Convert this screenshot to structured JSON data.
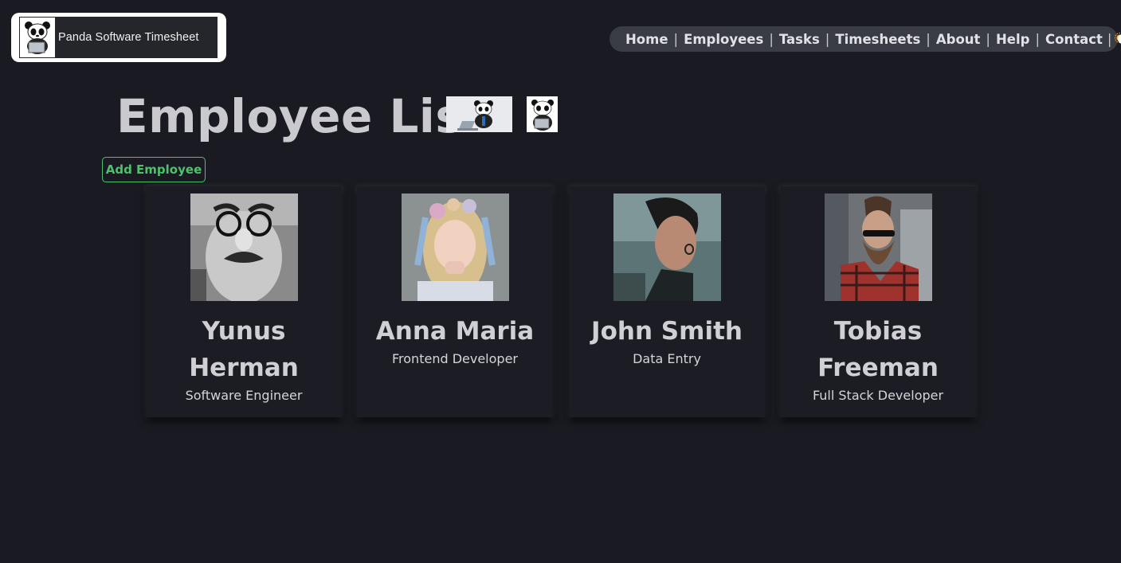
{
  "header": {
    "logo_text": "Panda Software Timesheet"
  },
  "nav": {
    "items": [
      "Home",
      "Employees",
      "Tasks",
      "Timesheets",
      "About",
      "Help",
      "Contact"
    ],
    "separator": "|",
    "theme_sun_icon": "sun-icon",
    "theme_moon_icon": "moon-icon"
  },
  "main": {
    "title": "Employee List",
    "add_button": "Add Employee"
  },
  "employees": [
    {
      "name": "Yunus Herman",
      "role": "Software Engineer"
    },
    {
      "name": "Anna Maria",
      "role": "Frontend Developer"
    },
    {
      "name": "John Smith",
      "role": "Data Entry"
    },
    {
      "name": "Tobias Freeman",
      "role": "Full Stack Developer"
    }
  ],
  "colors": {
    "background": "#1a1b22",
    "accent_green": "#4ec26b",
    "nav_bg": "#3a3c45"
  }
}
